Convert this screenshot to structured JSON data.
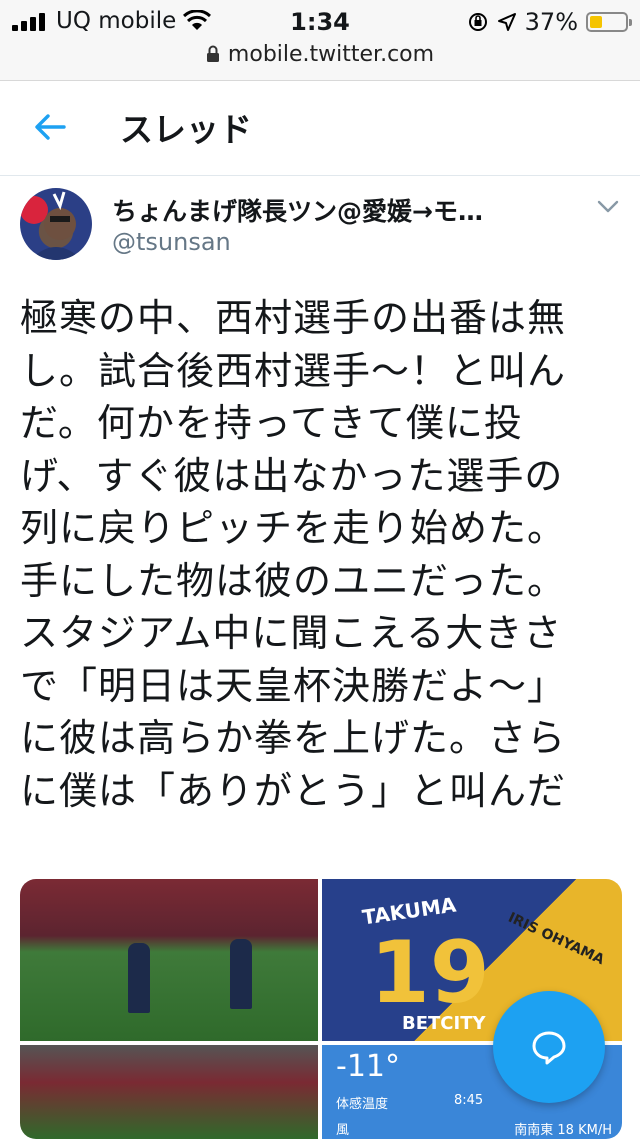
{
  "status_bar": {
    "carrier": "UQ mobile",
    "time": "1:34",
    "battery": "37%",
    "battery_level": 0.37,
    "url": "mobile.twitter.com"
  },
  "header": {
    "title": "スレッド"
  },
  "tweet": {
    "display_name": "ちょんまげ隊長ツン@愛媛→モ…",
    "handle": "@tsunsan",
    "lines": [
      "極寒の中、西村選手の出番は無",
      "し。試合後西村選手〜！と叫ん",
      "だ。何かを持ってきて僕に投",
      "げ、すぐ彼は出なかった選手の",
      "列に戻りピッチを走り始めた。",
      "手にした物は彼のユニだった。",
      "スタジアム中に聞こえる大きさ",
      "で「明日は天皇杯決勝だよ〜」",
      "に彼は高らか拳を上げた。さら",
      "に僕は「ありがとう」と叫んだ"
    ]
  },
  "media": {
    "jersey_name": "TAKUMA",
    "jersey_number": "19",
    "jersey_sponsor": "BETCITY",
    "jersey2_text": "IRIS OHYAMA",
    "weather": {
      "temp": "-11°",
      "feels_like_label": "体感温度",
      "time": "8:45",
      "wind_label": "風",
      "wind_value": "南南東 18 KM/H"
    }
  },
  "colors": {
    "accent": "#1da1f2",
    "text": "#14171a",
    "muted": "#657786"
  }
}
